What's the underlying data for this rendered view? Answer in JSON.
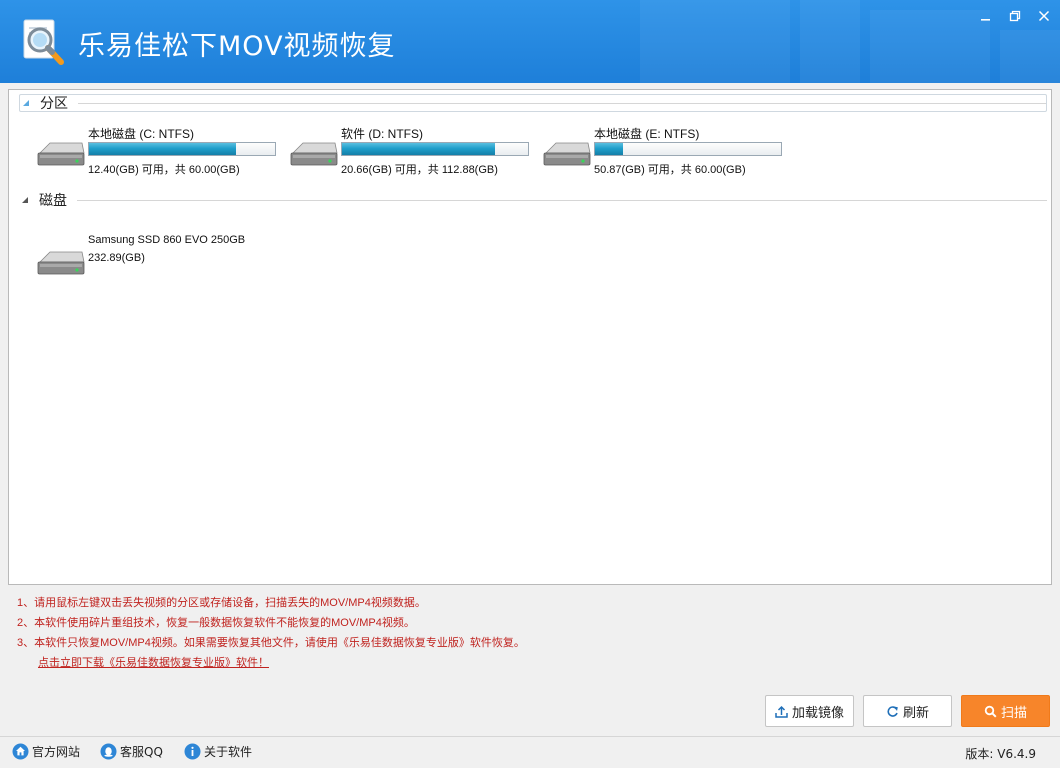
{
  "app": {
    "title": "乐易佳松下MOV视频恢复"
  },
  "colors": {
    "titlebar": "#1e7fd9",
    "accent": "#f7852a",
    "bar_fill": "#1f9fcb",
    "note_red": "#c0231f"
  },
  "partitions_group": {
    "label": "分区",
    "drives": [
      {
        "name": "本地磁盘 (C: NTFS)",
        "info": "12.40(GB) 可用，共 60.00(GB)",
        "used_fraction": 0.79
      },
      {
        "name": "软件 (D: NTFS)",
        "info": "20.66(GB) 可用，共 112.88(GB)",
        "used_fraction": 0.82
      },
      {
        "name": "本地磁盘 (E: NTFS)",
        "info": "50.87(GB) 可用，共 60.00(GB)",
        "used_fraction": 0.15
      }
    ]
  },
  "disks_group": {
    "label": "磁盘",
    "disks": [
      {
        "name": "Samsung SSD 860 EVO 250GB",
        "size": "232.89(GB)"
      }
    ]
  },
  "notes": {
    "line1": "1、请用鼠标左键双击丢失视频的分区或存储设备，扫描丢失的MOV/MP4视频数据。",
    "line2": "2、本软件使用碎片重组技术，恢复一般数据恢复软件不能恢复的MOV/MP4视频。",
    "line3": "3、本软件只恢复MOV/MP4视频。如果需要恢复其他文件，请使用《乐易佳数据恢复专业版》软件恢复。",
    "link": "点击立即下载《乐易佳数据恢复专业版》软件！"
  },
  "buttons": {
    "load_image": "加载镜像",
    "refresh": "刷新",
    "scan": "扫描"
  },
  "statusbar": {
    "website": "官方网站",
    "support_qq": "客服QQ",
    "about": "关于软件",
    "version": "版本: V6.4.9"
  }
}
